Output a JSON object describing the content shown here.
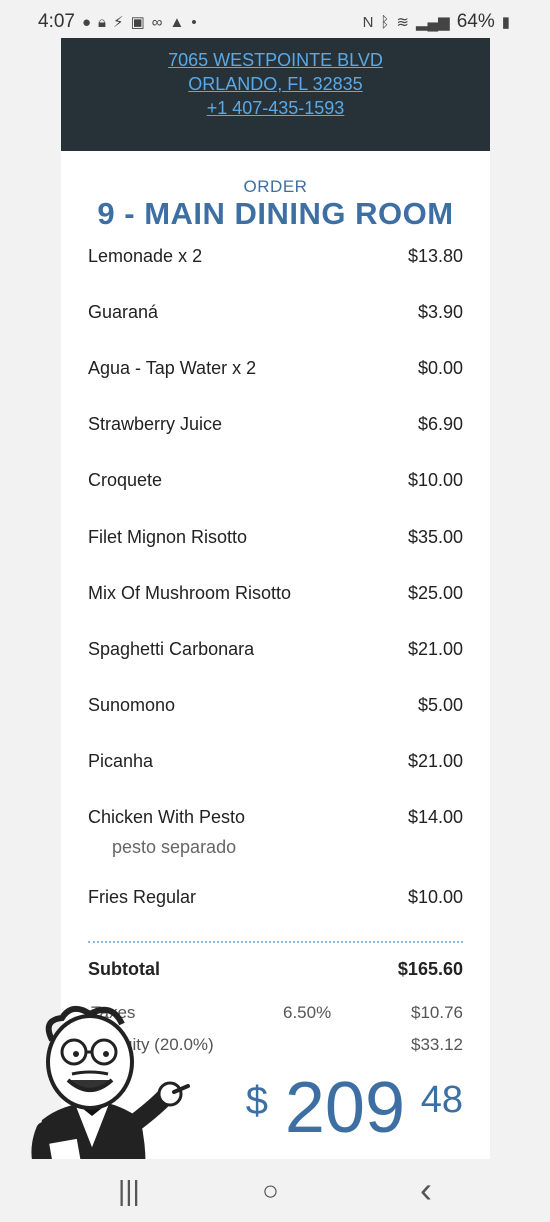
{
  "status_bar": {
    "time": "4:07",
    "battery": "64%",
    "left_icons": [
      "chat-icon",
      "lock-icon",
      "bolt-icon",
      "ring-icon",
      "link-icon",
      "arrow-icon",
      "dot-icon"
    ],
    "right_icons": [
      "nfc-icon",
      "bluetooth-icon",
      "wifi-icon",
      "signal-icon",
      "battery-icon"
    ]
  },
  "header": {
    "address_line1": "7065 WESTPOINTE BLVD",
    "address_line2": "ORLANDO, FL 32835",
    "phone": "+1 407-435-1593"
  },
  "order": {
    "label": "ORDER",
    "title": "9 - MAIN DINING ROOM",
    "items": [
      {
        "name": "Lemonade x 2",
        "price": "$13.80"
      },
      {
        "name": "Guaraná",
        "price": "$3.90"
      },
      {
        "name": "Agua - Tap Water x 2",
        "price": "$0.00"
      },
      {
        "name": "Strawberry Juice",
        "price": "$6.90"
      },
      {
        "name": "Croquete",
        "price": "$10.00"
      },
      {
        "name": "Filet Mignon Risotto",
        "price": "$35.00"
      },
      {
        "name": "Mix Of Mushroom Risotto",
        "price": "$25.00"
      },
      {
        "name": "Spaghetti Carbonara",
        "price": "$21.00"
      },
      {
        "name": "Sunomono",
        "price": "$5.00"
      },
      {
        "name": "Picanha",
        "price": "$21.00"
      },
      {
        "name": "Chicken With Pesto",
        "price": "$14.00",
        "note": "pesto separado"
      },
      {
        "name": "Fries Regular",
        "price": "$10.00"
      }
    ]
  },
  "totals": {
    "subtotal_label": "Subtotal",
    "subtotal": "$165.60",
    "taxes_label": "Taxes",
    "taxes_rate": "6.50%",
    "taxes": "$10.76",
    "gratuity_label": "uity (20.0%)",
    "gratuity": "$33.12",
    "currency": "$",
    "total_whole": "209",
    "total_cents": "48"
  },
  "navbar": {
    "recents": "|||",
    "home": "○",
    "back": "‹"
  },
  "colors": {
    "accent": "#3d6fa3",
    "header_bg": "#263238",
    "link": "#5aa9e6"
  }
}
